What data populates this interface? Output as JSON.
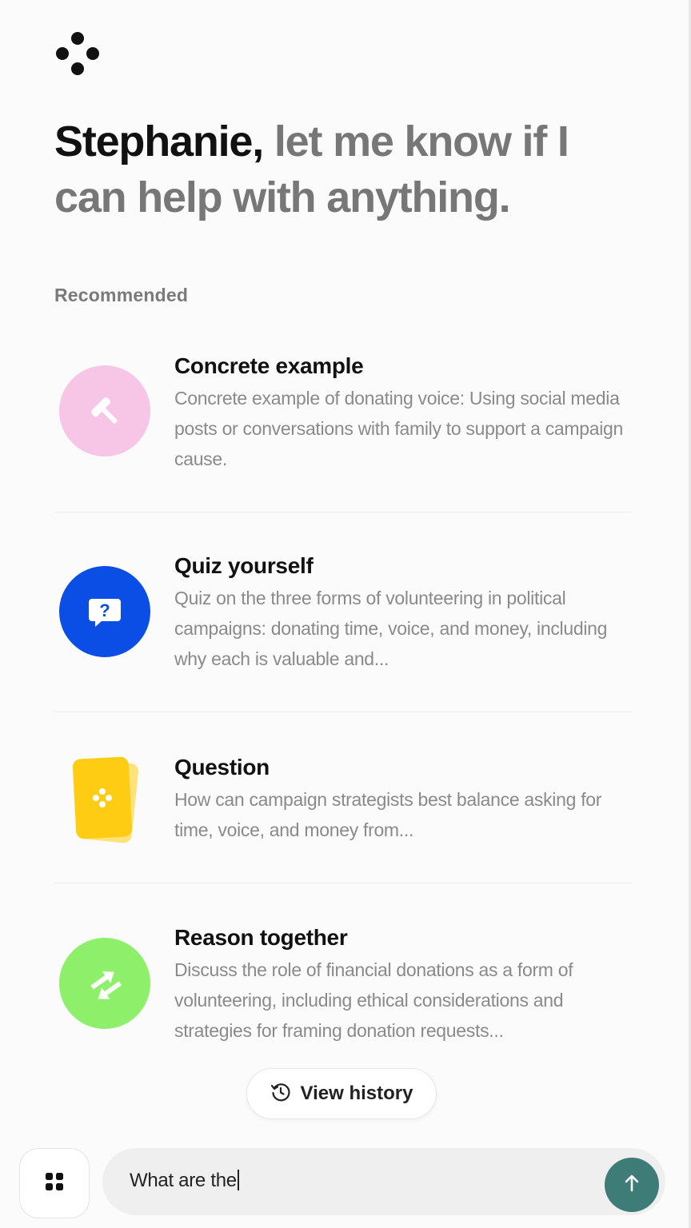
{
  "greeting": {
    "name": "Stephanie,",
    "rest": " let me know if I can help with anything."
  },
  "recommended": {
    "label": "Recommended",
    "items": [
      {
        "title": "Concrete example",
        "description": "Concrete example of donating voice: Using social media posts or conversations with family to support a campaign cause.",
        "icon": "hammer-icon",
        "color": "#f7c6e6"
      },
      {
        "title": "Quiz yourself",
        "description": "Quiz on the three forms of volunteering in political campaigns: donating time, voice, and money, including why each is valuable and...",
        "icon": "question-bubble-icon",
        "color": "#0a4ee6"
      },
      {
        "title": "Question",
        "description": "How can campaign strategists best balance asking for time, voice, and money from...",
        "icon": "question-card-icon",
        "color": "#ffcc14"
      },
      {
        "title": "Reason together",
        "description": "Discuss the role of financial donations as a form of volunteering, including ethical considerations and strategies for framing donation requests...",
        "icon": "swap-arrows-icon",
        "color": "#8ef06a"
      }
    ]
  },
  "history_button": {
    "label": "View history"
  },
  "composer": {
    "value": "What are the",
    "accent": "#3d7c77"
  }
}
